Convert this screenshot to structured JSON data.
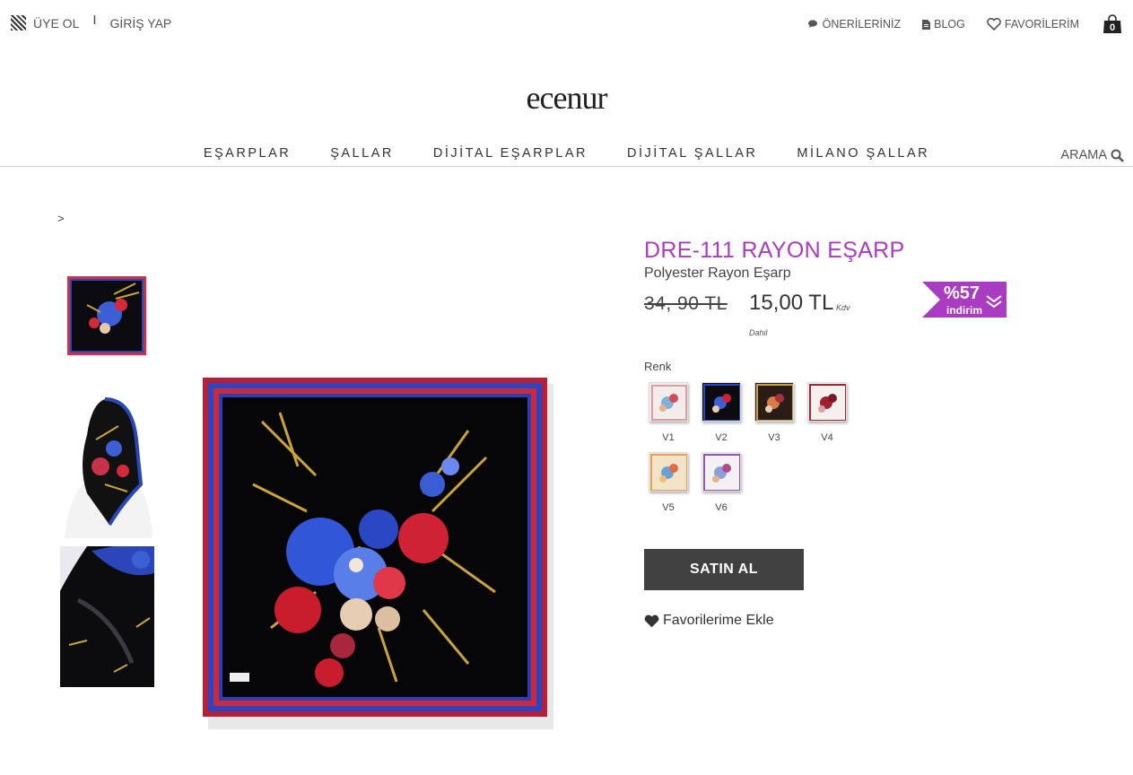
{
  "top_left": {
    "register": "ÜYE OL",
    "separator": "I",
    "login": "GİRİŞ YAP"
  },
  "top_right": {
    "suggestions": "ÖNERİLERİNİZ",
    "blog": "BLOG",
    "favorites": "FAVORİLERİM",
    "cart_count": "0"
  },
  "logo": "ecenur",
  "nav": {
    "items": [
      "EŞARPLAR",
      "ŞALLAR",
      "DİJİTAL EŞARPLAR",
      "DİJİTAL ŞALLAR",
      "MİLANO ŞALLAR"
    ],
    "search": "ARAMA"
  },
  "breadcrumb": ">",
  "product": {
    "title": "DRE-111 RAYON EŞARP",
    "subtitle": "Polyester Rayon Eşarp",
    "old_price": "34, 90 TL",
    "new_price": "15,00 TL",
    "tax_note_1": "Kdv",
    "tax_note_2": "Dahil",
    "discount_pct": "%57",
    "discount_label": "indirim",
    "color_label": "Renk",
    "variants": [
      "V1",
      "V2",
      "V3",
      "V4",
      "V5",
      "V6"
    ],
    "buy_label": "SATIN AL",
    "fav_label": "Favorilerime Ekle"
  },
  "colors": {
    "accent": "#a93cc0",
    "button": "#414141"
  }
}
